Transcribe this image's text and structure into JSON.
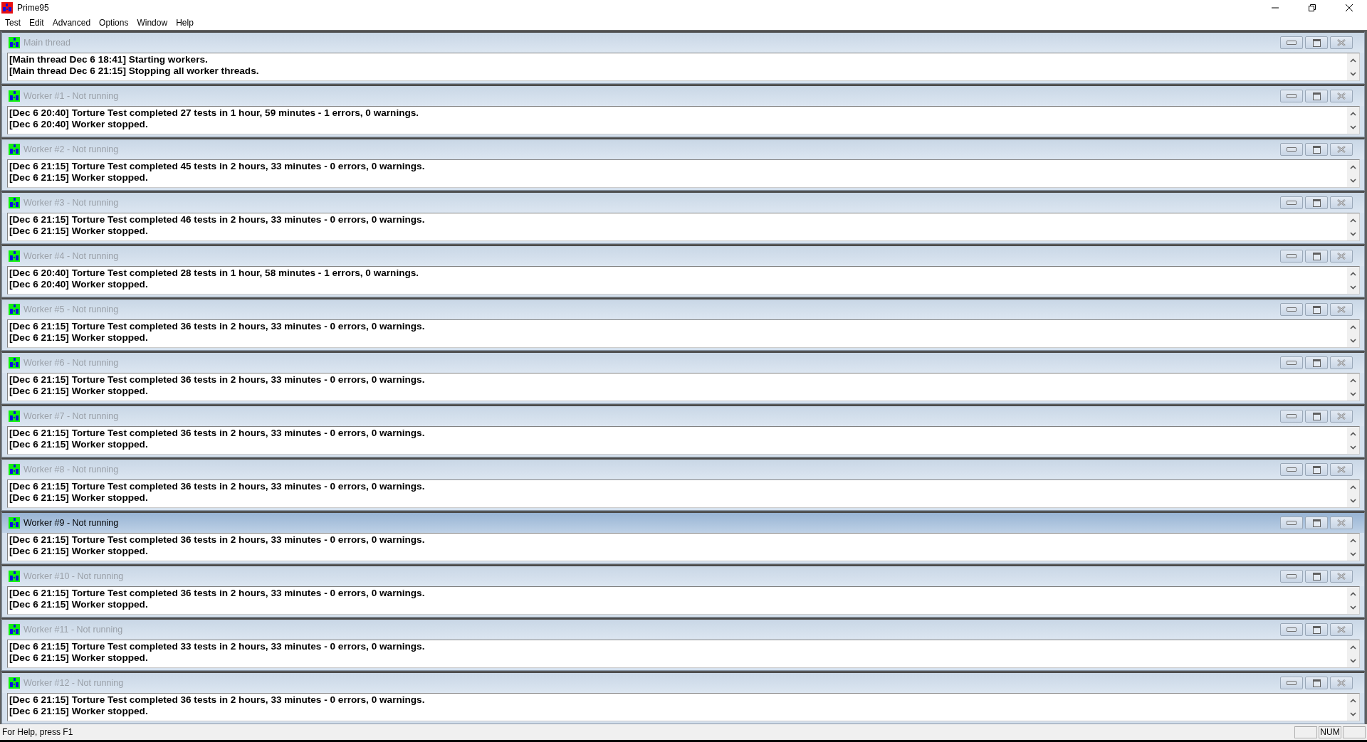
{
  "window": {
    "title": "Prime95"
  },
  "menu": [
    "Test",
    "Edit",
    "Advanced",
    "Options",
    "Window",
    "Help"
  ],
  "panes": [
    {
      "title": "Main thread",
      "active": false,
      "lines": [
        "[Main thread Dec 6 18:41] Starting workers.",
        "[Main thread Dec 6 21:15] Stopping all worker threads."
      ]
    },
    {
      "title": "Worker #1 - Not running",
      "active": false,
      "lines": [
        "[Dec 6 20:40] Torture Test completed 27 tests in 1 hour, 59 minutes - 1 errors, 0 warnings.",
        "[Dec 6 20:40] Worker stopped."
      ]
    },
    {
      "title": "Worker #2 - Not running",
      "active": false,
      "lines": [
        "[Dec 6 21:15] Torture Test completed 45 tests in 2 hours, 33 minutes - 0 errors, 0 warnings.",
        "[Dec 6 21:15] Worker stopped."
      ]
    },
    {
      "title": "Worker #3 - Not running",
      "active": false,
      "lines": [
        "[Dec 6 21:15] Torture Test completed 46 tests in 2 hours, 33 minutes - 0 errors, 0 warnings.",
        "[Dec 6 21:15] Worker stopped."
      ]
    },
    {
      "title": "Worker #4 - Not running",
      "active": false,
      "lines": [
        "[Dec 6 20:40] Torture Test completed 28 tests in 1 hour, 58 minutes - 1 errors, 0 warnings.",
        "[Dec 6 20:40] Worker stopped."
      ]
    },
    {
      "title": "Worker #5 - Not running",
      "active": false,
      "lines": [
        "[Dec 6 21:15] Torture Test completed 36 tests in 2 hours, 33 minutes - 0 errors, 0 warnings.",
        "[Dec 6 21:15] Worker stopped."
      ]
    },
    {
      "title": "Worker #6 - Not running",
      "active": false,
      "lines": [
        "[Dec 6 21:15] Torture Test completed 36 tests in 2 hours, 33 minutes - 0 errors, 0 warnings.",
        "[Dec 6 21:15] Worker stopped."
      ]
    },
    {
      "title": "Worker #7 - Not running",
      "active": false,
      "lines": [
        "[Dec 6 21:15] Torture Test completed 36 tests in 2 hours, 33 minutes - 0 errors, 0 warnings.",
        "[Dec 6 21:15] Worker stopped."
      ]
    },
    {
      "title": "Worker #8 - Not running",
      "active": false,
      "lines": [
        "[Dec 6 21:15] Torture Test completed 36 tests in 2 hours, 33 minutes - 0 errors, 0 warnings.",
        "[Dec 6 21:15] Worker stopped."
      ]
    },
    {
      "title": "Worker #9 - Not running",
      "active": true,
      "lines": [
        "[Dec 6 21:15] Torture Test completed 36 tests in 2 hours, 33 minutes - 0 errors, 0 warnings.",
        "[Dec 6 21:15] Worker stopped."
      ]
    },
    {
      "title": "Worker #10 - Not running",
      "active": false,
      "lines": [
        "[Dec 6 21:15] Torture Test completed 36 tests in 2 hours, 33 minutes - 0 errors, 0 warnings.",
        "[Dec 6 21:15] Worker stopped."
      ]
    },
    {
      "title": "Worker #11 - Not running",
      "active": false,
      "lines": [
        "[Dec 6 21:15] Torture Test completed 33 tests in 2 hours, 33 minutes - 0 errors, 0 warnings.",
        "[Dec 6 21:15] Worker stopped."
      ]
    },
    {
      "title": "Worker #12 - Not running",
      "active": false,
      "lines": [
        "[Dec 6 21:15] Torture Test completed 36 tests in 2 hours, 33 minutes - 0 errors, 0 warnings.",
        "[Dec 6 21:15] Worker stopped."
      ]
    }
  ],
  "status_bar": {
    "text": "For Help, press F1",
    "indicator": "NUM"
  }
}
